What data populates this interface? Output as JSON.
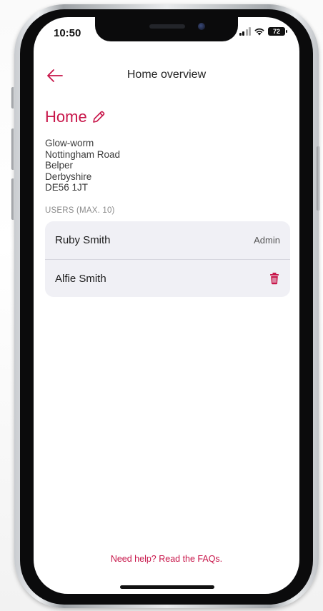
{
  "status_bar": {
    "time": "10:50",
    "battery": "72"
  },
  "header": {
    "title": "Home overview",
    "back_icon": "arrow-left-icon"
  },
  "home": {
    "name": "Home",
    "edit_icon": "pencil-icon",
    "address_lines": [
      "Glow-worm",
      "Nottingham Road",
      "Belper",
      "Derbyshire",
      "DE56 1JT"
    ]
  },
  "users": {
    "heading": "USERS (MAX. 10)",
    "items": [
      {
        "name": "Ruby Smith",
        "role": "Admin"
      },
      {
        "name": "Alfie Smith",
        "role": "",
        "delete_icon": "trash-icon"
      }
    ]
  },
  "footer": {
    "help_link": "Need help? Read the FAQs."
  },
  "colors": {
    "accent": "#c8164a",
    "card_background": "#f0f0f5"
  }
}
